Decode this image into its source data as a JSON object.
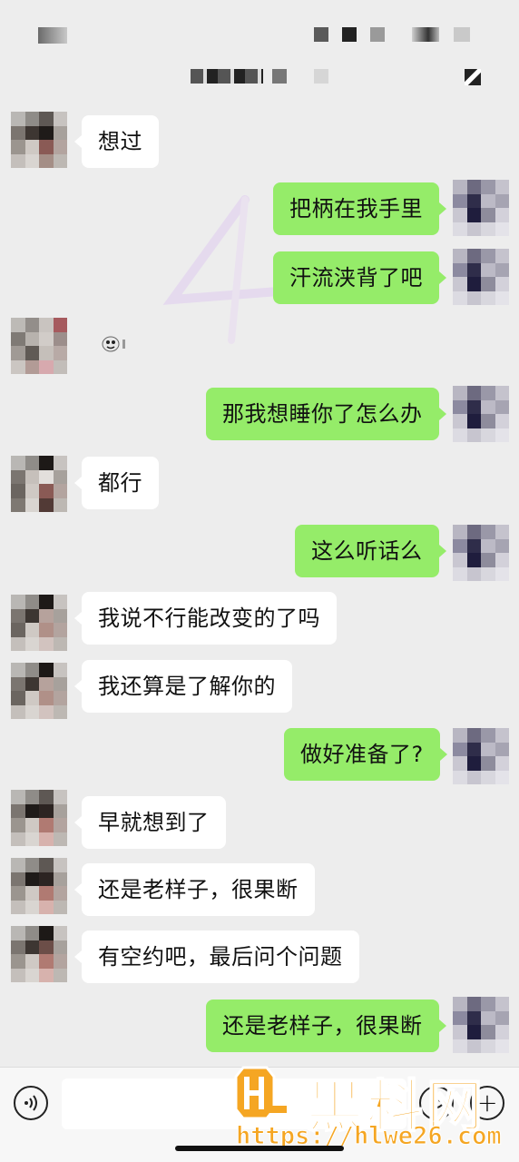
{
  "messages": [
    {
      "side": "recv",
      "text": "想过"
    },
    {
      "side": "sent",
      "text": "把柄在我手里"
    },
    {
      "side": "sent",
      "text": "汗流浃背了吧"
    },
    {
      "side": "recv",
      "text": ""
    },
    {
      "side": "sent",
      "text": "那我想睡你了怎么办"
    },
    {
      "side": "recv",
      "text": "都行"
    },
    {
      "side": "sent",
      "text": "这么听话么"
    },
    {
      "side": "recv",
      "text": "我说不行能改变的了吗"
    },
    {
      "side": "recv",
      "text": "我还算是了解你的"
    },
    {
      "side": "sent",
      "text": "做好准备了?"
    },
    {
      "side": "recv",
      "text": "早就想到了"
    },
    {
      "side": "recv",
      "text": "还是老样子，很果断"
    },
    {
      "side": "recv",
      "text": "有空约吧，最后问个问题"
    },
    {
      "side": "sent",
      "text": "还是老样子，很果断"
    }
  ],
  "input_bar": {
    "voice_icon": "voice-icon",
    "emoji_icon": "emoji-icon",
    "plus_icon": "plus-icon",
    "plus_glyph": "+"
  },
  "watermark": {
    "brand": "黑料网",
    "url": "https://hlwe26.com"
  },
  "colors": {
    "background": "#ededed",
    "sent_bubble": "#95ec69",
    "recv_bubble": "#ffffff",
    "watermark_orange": "#f5a623"
  }
}
